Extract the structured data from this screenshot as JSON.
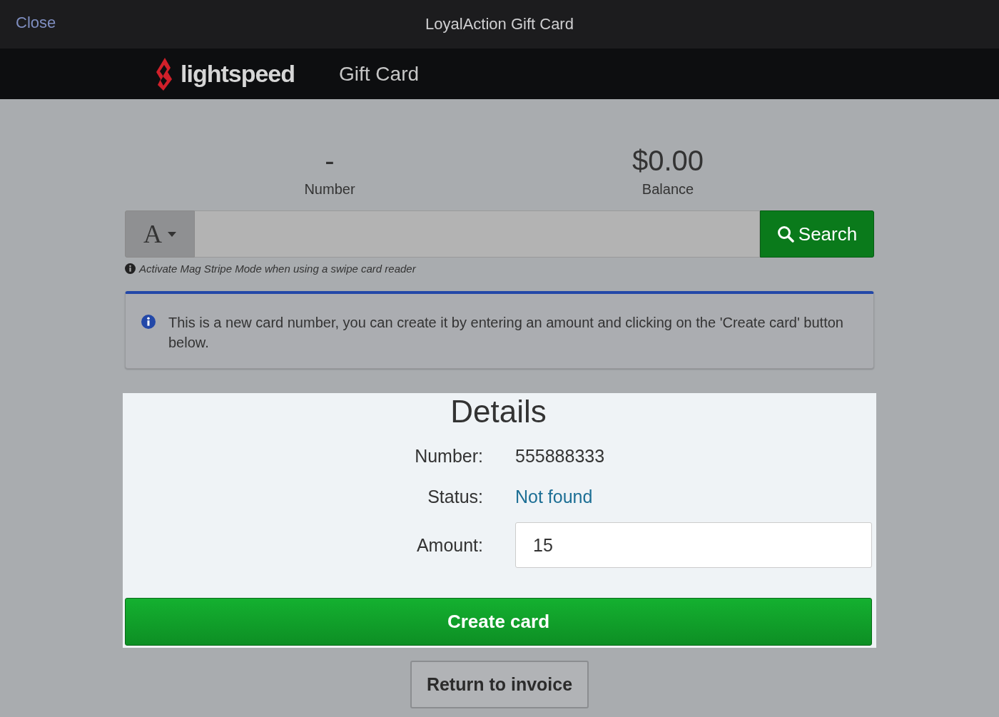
{
  "window": {
    "close": "Close",
    "title": "LoyalAction Gift Card"
  },
  "navbar": {
    "brand": "lightspeed",
    "item": "Gift Card"
  },
  "summary": [
    {
      "value": "-",
      "label": "Number"
    },
    {
      "value": "$0.00",
      "label": "Balance"
    }
  ],
  "search": {
    "mode": "A",
    "button": "Search",
    "help": "Activate Mag Stripe Mode when using a swipe card reader"
  },
  "alert": {
    "text": "This is a new card number, you can create it by entering an amount and clicking on the 'Create card' button below."
  },
  "details": {
    "title": "Details",
    "fields": [
      {
        "label": "Number:",
        "value": "555888333",
        "kind": "text"
      },
      {
        "label": "Status:",
        "value": "Not found",
        "kind": "status"
      },
      {
        "label": "Amount:",
        "value": "15",
        "kind": "input"
      }
    ]
  },
  "buttons": {
    "create": "Create card",
    "return": "Return to invoice"
  }
}
